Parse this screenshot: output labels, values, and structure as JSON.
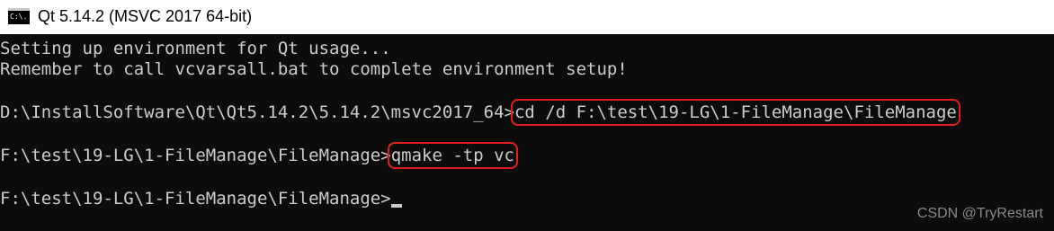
{
  "window": {
    "icon_text": "C:\\.",
    "title": "Qt 5.14.2 (MSVC 2017 64-bit)"
  },
  "console": {
    "line1": "Setting up environment for Qt usage...",
    "line2": "Remember to call vcvarsall.bat to complete environment setup!",
    "prompt1": "D:\\InstallSoftware\\Qt\\Qt5.14.2\\5.14.2\\msvc2017_64>",
    "cmd1": "cd /d F:\\test\\19-LG\\1-FileManage\\FileManage",
    "prompt2": "F:\\test\\19-LG\\1-FileManage\\FileManage>",
    "cmd2": "qmake -tp vc",
    "prompt3": "F:\\test\\19-LG\\1-FileManage\\FileManage>"
  },
  "watermark": "CSDN @TryRestart",
  "colors": {
    "console_bg": "#0c0c0c",
    "console_text": "#cccccc",
    "highlight": "#e0201e"
  }
}
